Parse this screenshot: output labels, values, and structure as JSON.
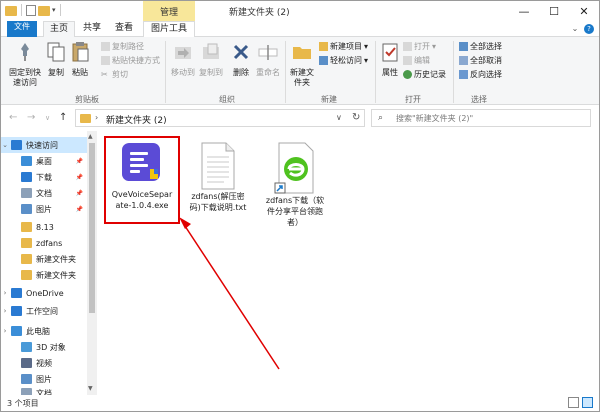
{
  "window": {
    "title": "新建文件夹 (2)",
    "contextual_tab_group": "管理"
  },
  "ribbon_tabs": {
    "file": "文件",
    "home": "主页",
    "share": "共享",
    "view": "查看",
    "picture_tools": "图片工具"
  },
  "ribbon": {
    "clipboard": {
      "pin": "固定到快速访问",
      "copy": "复制",
      "paste": "粘贴",
      "copy_path": "复制路径",
      "paste_shortcut": "粘贴快捷方式",
      "cut": "剪切",
      "group": "剪贴板"
    },
    "organize": {
      "move_to": "移动到",
      "copy_to": "复制到",
      "delete": "删除",
      "rename": "重命名",
      "group": "组织"
    },
    "new": {
      "new_folder": "新建文件夹",
      "new_item": "新建项目",
      "easy_access": "轻松访问",
      "group": "新建"
    },
    "open": {
      "properties": "属性",
      "open": "打开",
      "edit": "编辑",
      "history": "历史记录",
      "group": "打开"
    },
    "select": {
      "select_all": "全部选择",
      "select_none": "全部取消",
      "invert": "反向选择",
      "group": "选择"
    }
  },
  "address": {
    "crumb": "新建文件夹 (2)",
    "search_placeholder": "搜索\"新建文件夹 (2)\""
  },
  "sidebar": {
    "items": [
      {
        "label": "快速访问",
        "icon": "star-icon",
        "color": "#2a7ad2",
        "pinned": false
      },
      {
        "label": "桌面",
        "icon": "desktop-icon",
        "color": "#3b8ed8",
        "pinned": true
      },
      {
        "label": "下载",
        "icon": "download-icon",
        "color": "#2a7ad2",
        "pinned": true
      },
      {
        "label": "文档",
        "icon": "documents-icon",
        "color": "#8ca0b8",
        "pinned": true
      },
      {
        "label": "图片",
        "icon": "pictures-icon",
        "color": "#5a8fc8",
        "pinned": true
      },
      {
        "label": "8.13",
        "icon": "folder-icon",
        "color": "#e8b84a",
        "pinned": false
      },
      {
        "label": "zdfans",
        "icon": "folder-icon",
        "color": "#e8b84a",
        "pinned": false
      },
      {
        "label": "新建文件夹",
        "icon": "folder-icon",
        "color": "#e8b84a",
        "pinned": false
      },
      {
        "label": "新建文件夹",
        "icon": "folder-icon",
        "color": "#e8b84a",
        "pinned": false
      },
      {
        "label": "OneDrive",
        "icon": "onedrive-icon",
        "color": "#2a7ad2",
        "pinned": false
      },
      {
        "label": "工作空间",
        "icon": "workspace-icon",
        "color": "#2a7ad2",
        "pinned": false
      },
      {
        "label": "此电脑",
        "icon": "pc-icon",
        "color": "#3b8ed8",
        "pinned": false
      },
      {
        "label": "3D 对象",
        "icon": "3d-objects-icon",
        "color": "#4a9ad8",
        "pinned": false
      },
      {
        "label": "视频",
        "icon": "videos-icon",
        "color": "#5a6a88",
        "pinned": false
      },
      {
        "label": "图片",
        "icon": "pictures-icon",
        "color": "#5a8fc8",
        "pinned": false
      },
      {
        "label": "文档",
        "icon": "documents-icon",
        "color": "#8ca0b8",
        "pinned": false
      }
    ]
  },
  "files": [
    {
      "name": "QveVoiceSeparate-1.0.4.exe",
      "line1": "QveVoiceSepar",
      "line2": "ate-1.0.4.exe",
      "line3": "",
      "icon": "qve-app-icon"
    },
    {
      "name": "zdfans(解压密码)下载说明.txt",
      "line1": "zdfans(解压密",
      "line2": "码)下载说明.txt",
      "line3": "",
      "icon": "text-file-icon"
    },
    {
      "name": "zdfans下载（软件分享平台领跑者）",
      "line1": "zdfans下载（软",
      "line2": "件分享平台领跑",
      "line3": "者）",
      "icon": "ie-shortcut-icon"
    }
  ],
  "status": {
    "item_count": "3 个项目"
  },
  "colors": {
    "accent": "#1979ca",
    "highlight": "#e00000",
    "contextual": "#f8e79a",
    "selection": "#cce8ff"
  }
}
